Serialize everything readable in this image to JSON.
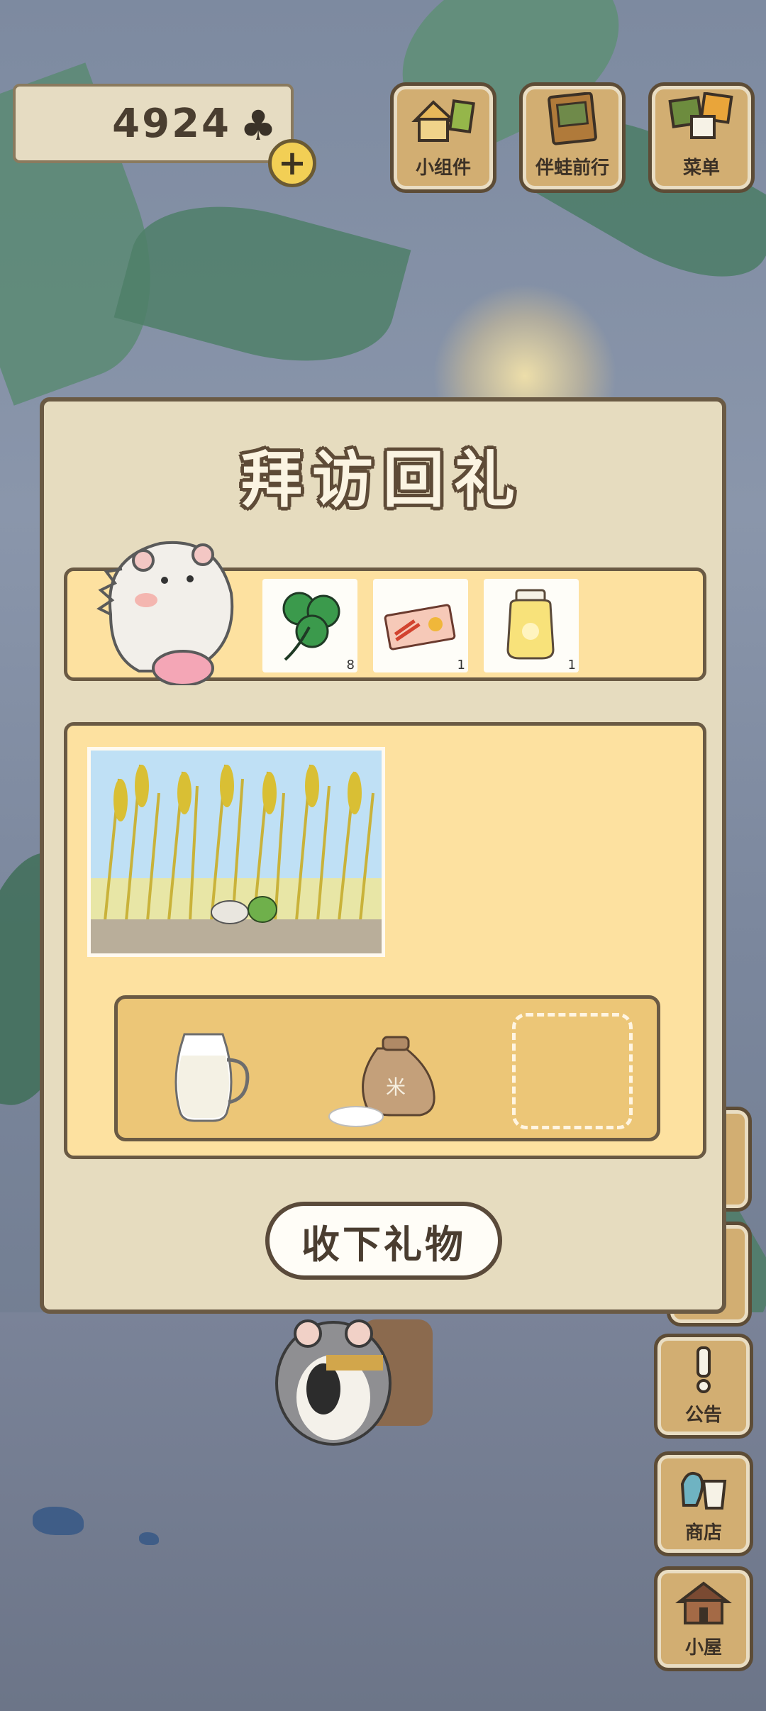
{
  "currency": {
    "amount": "4924",
    "symbol": "♣",
    "add_label": "+"
  },
  "top_buttons": [
    {
      "label": "小组件",
      "icon": "widget-icon"
    },
    {
      "label": "伴蛙前行",
      "icon": "album-icon"
    },
    {
      "label": "菜单",
      "icon": "menu-icon"
    }
  ],
  "side_buttons": [
    {
      "label": "公告",
      "icon": "exclamation-icon"
    },
    {
      "label": "商店",
      "icon": "shop-bag-icon"
    },
    {
      "label": "小屋",
      "icon": "house-icon"
    }
  ],
  "dialog": {
    "title": "拜访回礼",
    "gift_items": [
      {
        "name": "clover",
        "icon": "four-leaf-clover-icon",
        "count": "8"
      },
      {
        "name": "ticket",
        "icon": "ticket-icon",
        "count": "1"
      },
      {
        "name": "jar",
        "icon": "honey-jar-icon",
        "count": "1"
      }
    ],
    "photo_icon": "wheat-field-photo",
    "tray_items": [
      {
        "icon": "milk-pitcher-icon"
      },
      {
        "icon": "rice-sack-icon",
        "sack_text": "米"
      }
    ],
    "collect_button": "收下礼物"
  },
  "colors": {
    "panel_bg": "#e6dcbf",
    "panel_border": "#6a5a44",
    "row_bg": "#fde1a0",
    "tray_bg": "#ecc677",
    "button_wood": "#d2ae72"
  }
}
